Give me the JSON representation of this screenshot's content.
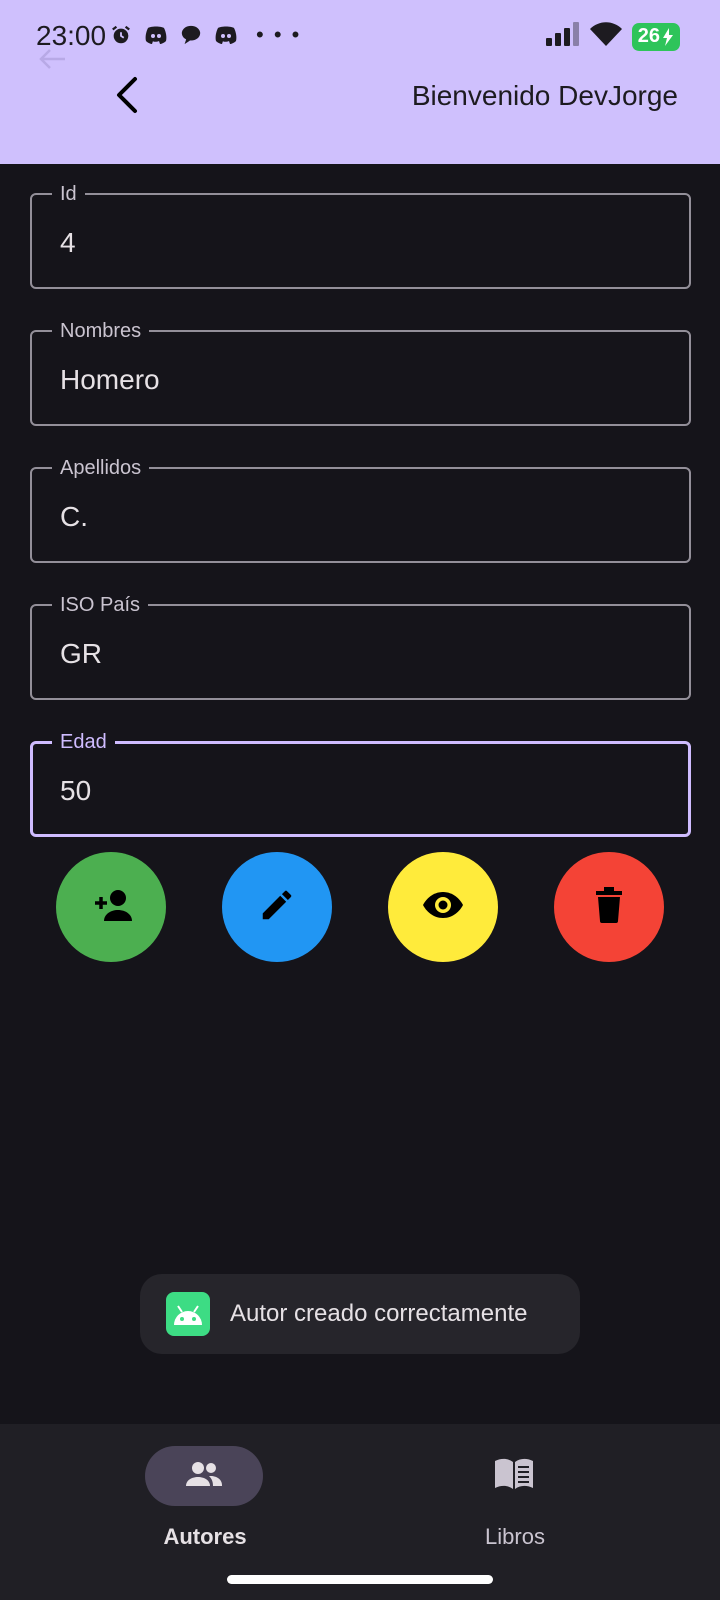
{
  "status_bar": {
    "time": "23:00",
    "battery": "26",
    "icons": [
      "alarm-icon",
      "discord-icon",
      "chat-bubble-icon",
      "discord-icon",
      "more-dots-icon",
      "signal-icon",
      "wifi-icon",
      "battery-charging-icon"
    ]
  },
  "app_bar": {
    "title": "Bienvenido DevJorge",
    "background": "#cfc0fd",
    "back_icon": "chevron-left-icon"
  },
  "form": {
    "fields": [
      {
        "label": "Id",
        "value": "4"
      },
      {
        "label": "Nombres",
        "value": "Homero"
      },
      {
        "label": "Apellidos",
        "value": "C."
      },
      {
        "label": "ISO País",
        "value": "GR"
      },
      {
        "label": "Edad",
        "value": "50",
        "focused": true
      }
    ]
  },
  "actions": [
    {
      "name": "add-author",
      "icon": "person-add-icon",
      "color": "#4caf50"
    },
    {
      "name": "edit-author",
      "icon": "pencil-icon",
      "color": "#2196f3"
    },
    {
      "name": "view-author",
      "icon": "eye-icon",
      "color": "#ffeb3b"
    },
    {
      "name": "delete-author",
      "icon": "trash-icon",
      "color": "#f44336"
    }
  ],
  "toast": {
    "message": "Autor creado correctamente",
    "icon": "android-icon"
  },
  "bottom_nav": {
    "items": [
      {
        "label": "Autores",
        "icon": "people-icon",
        "active": true
      },
      {
        "label": "Libros",
        "icon": "book-icon",
        "active": false
      }
    ]
  }
}
